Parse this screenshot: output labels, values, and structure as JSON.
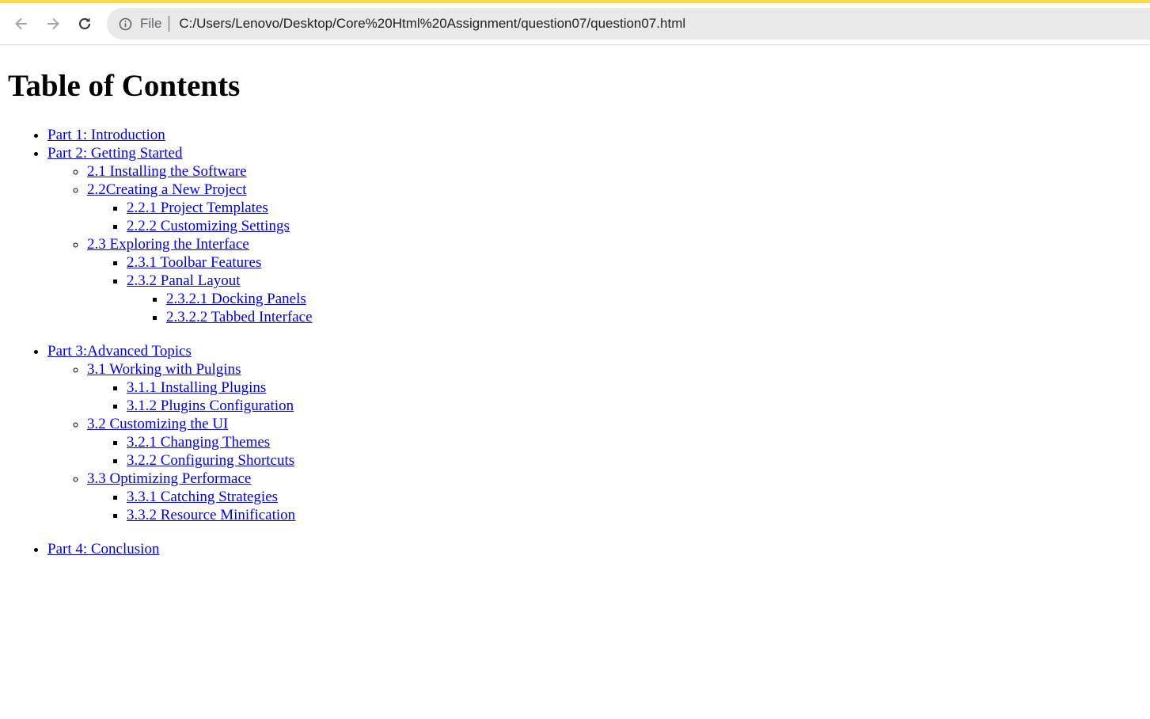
{
  "browser": {
    "scheme_label": "File",
    "url": "C:/Users/Lenovo/Desktop/Core%20Html%20Assignment/question07/question07.html",
    "accent_color": "#fdd94f"
  },
  "page": {
    "title": "Table of Contents",
    "toc": {
      "p1": "Part 1: Introduction",
      "p2": "Part 2: Getting Started",
      "p2_1": "2.1 Installing the Software",
      "p2_2": "2.2Creating a New Project",
      "p2_2_1": "2.2.1 Project Templates",
      "p2_2_2": "2.2.2 Customizing Settings",
      "p2_3": "2.3 Exploring the Interface",
      "p2_3_1": "2.3.1 Toolbar Features",
      "p2_3_2": "2.3.2 Panal Layout",
      "p2_3_2_1": "2.3.2.1 Docking Panels",
      "p2_3_2_2": "2.3.2.2 Tabbed Interface",
      "p3": "Part 3:Advanced Topics",
      "p3_1": "3.1 Working with Pulgins",
      "p3_1_1": "3.1.1 Installing Plugins",
      "p3_1_2": "3.1.2 Plugins Configuration",
      "p3_2": "3.2 Customizing the UI",
      "p3_2_1": "3.2.1 Changing Themes",
      "p3_2_2": "3.2.2 Configuring Shortcuts",
      "p3_3": "3.3 Optimizing Performace",
      "p3_3_1": "3.3.1 Catching Strategies",
      "p3_3_2": "3.3.2 Resource Minification",
      "p4": "Part 4: Conclusion"
    }
  }
}
